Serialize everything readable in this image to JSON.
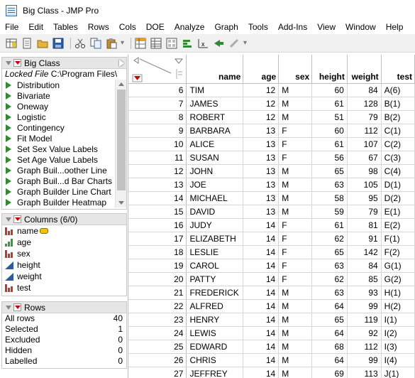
{
  "window": {
    "title": "Big Class - JMP Pro"
  },
  "menu": [
    "File",
    "Edit",
    "Tables",
    "Rows",
    "Cols",
    "DOE",
    "Analyze",
    "Graph",
    "Tools",
    "Add-Ins",
    "View",
    "Window",
    "Help"
  ],
  "table_panel": {
    "title": "Big Class",
    "locked_label": "Locked File",
    "locked_path": "C:\\Program Files\\",
    "scripts": [
      "Distribution",
      "Bivariate",
      "Oneway",
      "Logistic",
      "Contingency",
      "Fit Model",
      "Set Sex Value Labels",
      "Set Age Value Labels",
      "Graph Buil...oother Line",
      "Graph Buil...d Bar Charts",
      "Graph Builder Line Chart",
      "Graph Builder Heatmap"
    ]
  },
  "columns_panel": {
    "title": "Columns (6/0)",
    "columns": [
      "name",
      "age",
      "sex",
      "height",
      "weight",
      "test"
    ]
  },
  "rows_panel": {
    "title": "Rows",
    "stats": [
      {
        "label": "All rows",
        "value": "40"
      },
      {
        "label": "Selected",
        "value": "1"
      },
      {
        "label": "Excluded",
        "value": "0"
      },
      {
        "label": "Hidden",
        "value": "0"
      },
      {
        "label": "Labelled",
        "value": "0"
      }
    ]
  },
  "grid": {
    "headers": [
      "name",
      "age",
      "sex",
      "height",
      "weight",
      "test"
    ],
    "rows": [
      {
        "n": "6",
        "name": "TIM",
        "age": "12",
        "sex": "M",
        "height": "60",
        "weight": "84",
        "test": "A(6)"
      },
      {
        "n": "7",
        "name": "JAMES",
        "age": "12",
        "sex": "M",
        "height": "61",
        "weight": "128",
        "test": "B(1)"
      },
      {
        "n": "8",
        "name": "ROBERT",
        "age": "12",
        "sex": "M",
        "height": "51",
        "weight": "79",
        "test": "B(2)"
      },
      {
        "n": "9",
        "name": "BARBARA",
        "age": "13",
        "sex": "F",
        "height": "60",
        "weight": "112",
        "test": "C(1)"
      },
      {
        "n": "10",
        "name": "ALICE",
        "age": "13",
        "sex": "F",
        "height": "61",
        "weight": "107",
        "test": "C(2)"
      },
      {
        "n": "11",
        "name": "SUSAN",
        "age": "13",
        "sex": "F",
        "height": "56",
        "weight": "67",
        "test": "C(3)"
      },
      {
        "n": "12",
        "name": "JOHN",
        "age": "13",
        "sex": "M",
        "height": "65",
        "weight": "98",
        "test": "C(4)"
      },
      {
        "n": "13",
        "name": "JOE",
        "age": "13",
        "sex": "M",
        "height": "63",
        "weight": "105",
        "test": "D(1)"
      },
      {
        "n": "14",
        "name": "MICHAEL",
        "age": "13",
        "sex": "M",
        "height": "58",
        "weight": "95",
        "test": "D(2)"
      },
      {
        "n": "15",
        "name": "DAVID",
        "age": "13",
        "sex": "M",
        "height": "59",
        "weight": "79",
        "test": "E(1)"
      },
      {
        "n": "16",
        "name": "JUDY",
        "age": "14",
        "sex": "F",
        "height": "61",
        "weight": "81",
        "test": "E(2)"
      },
      {
        "n": "17",
        "name": "ELIZABETH",
        "age": "14",
        "sex": "F",
        "height": "62",
        "weight": "91",
        "test": "F(1)"
      },
      {
        "n": "18",
        "name": "LESLIE",
        "age": "14",
        "sex": "F",
        "height": "65",
        "weight": "142",
        "test": "F(2)"
      },
      {
        "n": "19",
        "name": "CAROL",
        "age": "14",
        "sex": "F",
        "height": "63",
        "weight": "84",
        "test": "G(1)"
      },
      {
        "n": "20",
        "name": "PATTY",
        "age": "14",
        "sex": "F",
        "height": "62",
        "weight": "85",
        "test": "G(2)"
      },
      {
        "n": "21",
        "name": "FREDERICK",
        "age": "14",
        "sex": "M",
        "height": "63",
        "weight": "93",
        "test": "H(1)"
      },
      {
        "n": "22",
        "name": "ALFRED",
        "age": "14",
        "sex": "M",
        "height": "64",
        "weight": "99",
        "test": "H(2)"
      },
      {
        "n": "23",
        "name": "HENRY",
        "age": "14",
        "sex": "M",
        "height": "65",
        "weight": "119",
        "test": "I(1)"
      },
      {
        "n": "24",
        "name": "LEWIS",
        "age": "14",
        "sex": "M",
        "height": "64",
        "weight": "92",
        "test": "I(2)"
      },
      {
        "n": "25",
        "name": "EDWARD",
        "age": "14",
        "sex": "M",
        "height": "68",
        "weight": "112",
        "test": "I(3)"
      },
      {
        "n": "26",
        "name": "CHRIS",
        "age": "14",
        "sex": "M",
        "height": "64",
        "weight": "99",
        "test": "I(4)"
      },
      {
        "n": "27",
        "name": "JEFFREY",
        "age": "14",
        "sex": "M",
        "height": "69",
        "weight": "113",
        "test": "J(1)"
      }
    ]
  },
  "colors": {
    "red_triangle": "#d40000",
    "play_green": "#2e8b2e",
    "nominal_red": "#c0392b",
    "continuous_blue": "#2c5aa0",
    "ordinal_green": "#3a9a3a"
  }
}
